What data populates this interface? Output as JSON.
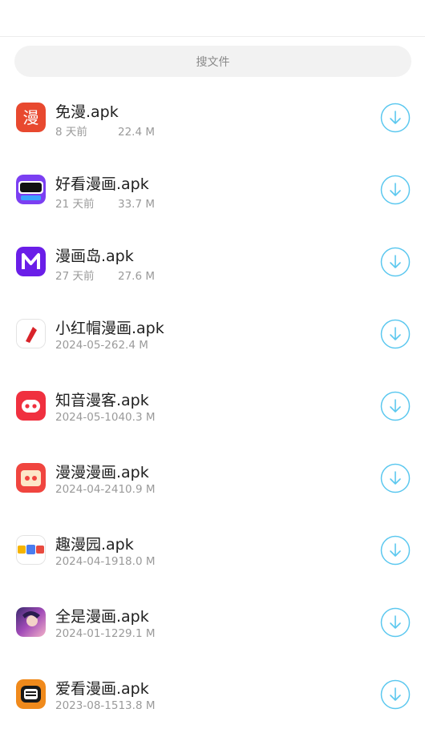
{
  "search": {
    "label": "搜文件"
  },
  "colors": {
    "accent": "#5cc8ef",
    "divider": "#ececec"
  },
  "files": [
    {
      "name": "免漫.apk",
      "date": "8 天前",
      "size": "22.4 M",
      "icon": "mianman-app-icon"
    },
    {
      "name": "好看漫画.apk",
      "date": "21 天前",
      "size": "33.7 M",
      "icon": "haokan-app-icon"
    },
    {
      "name": "漫画岛.apk",
      "date": "27 天前",
      "size": "27.6 M",
      "icon": "manhuadao-app-icon"
    },
    {
      "name": "小红帽漫画.apk",
      "date": "2024-05-26",
      "size": "2.4 M",
      "icon": "xiaohongmao-app-icon"
    },
    {
      "name": "知音漫客.apk",
      "date": "2024-05-10",
      "size": "40.3 M",
      "icon": "zhiyin-app-icon"
    },
    {
      "name": "漫漫漫画.apk",
      "date": "2024-04-24",
      "size": "10.9 M",
      "icon": "manman-app-icon"
    },
    {
      "name": "趣漫园.apk",
      "date": "2024-04-19",
      "size": "18.0 M",
      "icon": "qumanyuan-app-icon"
    },
    {
      "name": "全是漫画.apk",
      "date": "2024-01-12",
      "size": "29.1 M",
      "icon": "quanshi-app-icon"
    },
    {
      "name": "爱看漫画.apk",
      "date": "2023-08-15",
      "size": "13.8 M",
      "icon": "aikan-app-icon"
    }
  ]
}
